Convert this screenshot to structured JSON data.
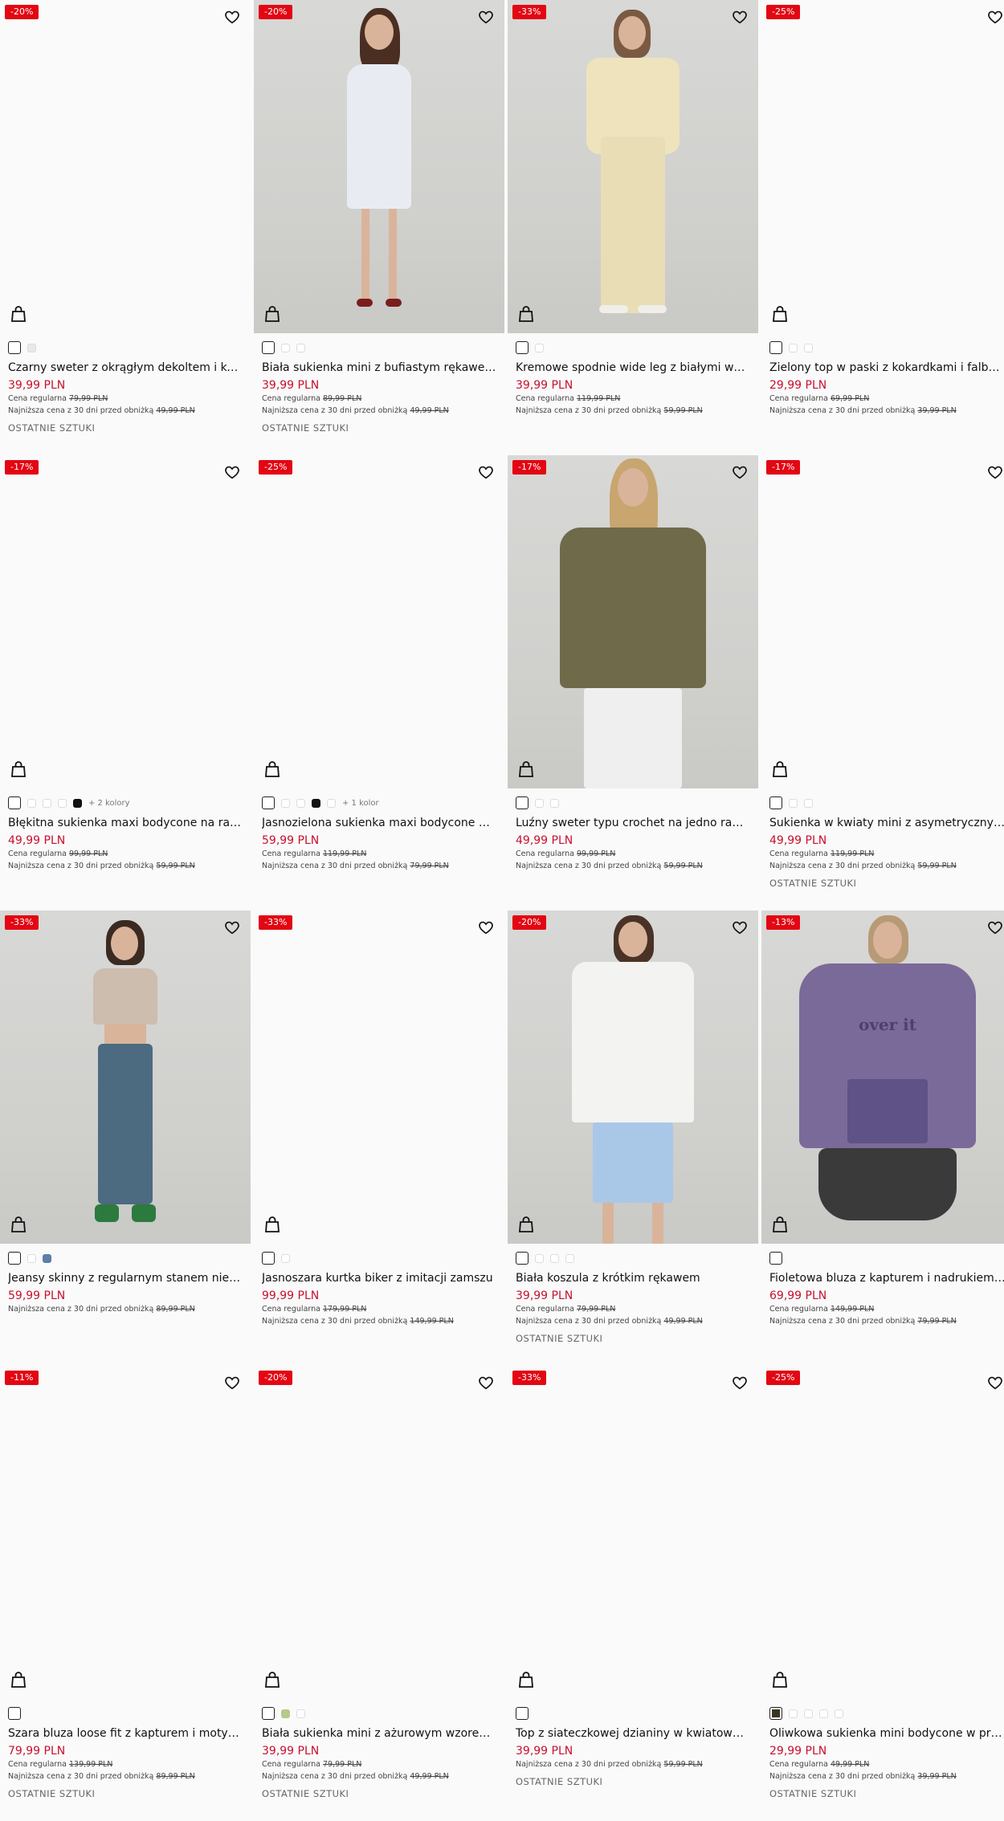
{
  "labels": {
    "regular": "Cena regularna",
    "lowest": "Najniższa cena z 30 dni przed obniżką"
  },
  "products": [
    {
      "discount": "-20%",
      "name": "Czarny sweter z okrągłym dekoltem i kokard...",
      "price": "39,99 PLN",
      "regular": "79,99 PLN",
      "lowest": "49,99 PLN",
      "flag": "OSTATNIE SZTUKI"
    },
    {
      "discount": "-20%",
      "name": "Biała sukienka mini z bufiastym rękawem i f...",
      "price": "39,99 PLN",
      "regular": "89,99 PLN",
      "lowest": "49,99 PLN",
      "flag": "OSTATNIE SZTUKI"
    },
    {
      "discount": "-33%",
      "name": "Kremowe spodnie wide leg z białymi wstaw...",
      "price": "39,99 PLN",
      "regular": "119,99 PLN",
      "lowest": "59,99 PLN",
      "flag": ""
    },
    {
      "discount": "-25%",
      "name": "Zielony top w paski z kokardkami i falbanką",
      "price": "29,99 PLN",
      "regular": "69,99 PLN",
      "lowest": "39,99 PLN",
      "flag": ""
    },
    {
      "discount": "-17%",
      "name": "Błękitna sukienka maxi bodycone na ramiąc...",
      "price": "49,99 PLN",
      "regular": "99,99 PLN",
      "lowest": "59,99 PLN",
      "flag": "",
      "more": "+ 2 kolory"
    },
    {
      "discount": "-25%",
      "name": "Jasnozielona sukienka maxi bodycone na ra...",
      "price": "59,99 PLN",
      "regular": "119,99 PLN",
      "lowest": "79,99 PLN",
      "flag": "",
      "more": "+ 1 kolor"
    },
    {
      "discount": "-17%",
      "name": "Luźny sweter typu crochet na jedno ramię ol...",
      "price": "49,99 PLN",
      "regular": "99,99 PLN",
      "lowest": "59,99 PLN",
      "flag": ""
    },
    {
      "discount": "-17%",
      "name": "Sukienka w kwiaty mini z asymetrycznym d...",
      "price": "49,99 PLN",
      "regular": "119,99 PLN",
      "lowest": "59,99 PLN",
      "flag": "OSTATNIE SZTUKI"
    },
    {
      "discount": "-33%",
      "name": "Jeansy skinny z regularnym stanem niebies...",
      "price": "59,99 PLN",
      "regular": "",
      "lowest": "89,99 PLN",
      "flag": ""
    },
    {
      "discount": "-33%",
      "name": "Jasnoszara kurtka biker z imitacji zamszu",
      "price": "99,99 PLN",
      "regular": "179,99 PLN",
      "lowest": "149,99 PLN",
      "flag": ""
    },
    {
      "discount": "-20%",
      "name": "Biała koszula z krótkim rękawem",
      "price": "39,99 PLN",
      "regular": "79,99 PLN",
      "lowest": "49,99 PLN",
      "flag": "OSTATNIE SZTUKI"
    },
    {
      "discount": "-13%",
      "name": "Fioletowa bluza z kapturem i nadrukiem Ove...",
      "price": "69,99 PLN",
      "regular": "149,99 PLN",
      "lowest": "79,99 PLN",
      "flag": "",
      "print": "over it"
    },
    {
      "discount": "-11%",
      "name": "Szara bluza loose fit z kapturem i motywem ...",
      "price": "79,99 PLN",
      "regular": "139,99 PLN",
      "lowest": "89,99 PLN",
      "flag": "OSTATNIE SZTUKI"
    },
    {
      "discount": "-20%",
      "name": "Biała sukienka mini z ażurowym wzorem i m...",
      "price": "39,99 PLN",
      "regular": "79,99 PLN",
      "lowest": "49,99 PLN",
      "flag": "OSTATNIE SZTUKI"
    },
    {
      "discount": "-33%",
      "name": "Top z siateczkowej dzianiny w kwiatowy wzór",
      "price": "39,99 PLN",
      "regular": "",
      "lowest": "59,99 PLN",
      "flag": "OSTATNIE SZTUKI"
    },
    {
      "discount": "-25%",
      "name": "Oliwkowa sukienka mini bodycone w prążki",
      "price": "29,99 PLN",
      "regular": "49,99 PLN",
      "lowest": "39,99 PLN",
      "flag": "OSTATNIE SZTUKI"
    }
  ],
  "colors": {
    "price": "#c8102e",
    "badge": "#e30613"
  }
}
